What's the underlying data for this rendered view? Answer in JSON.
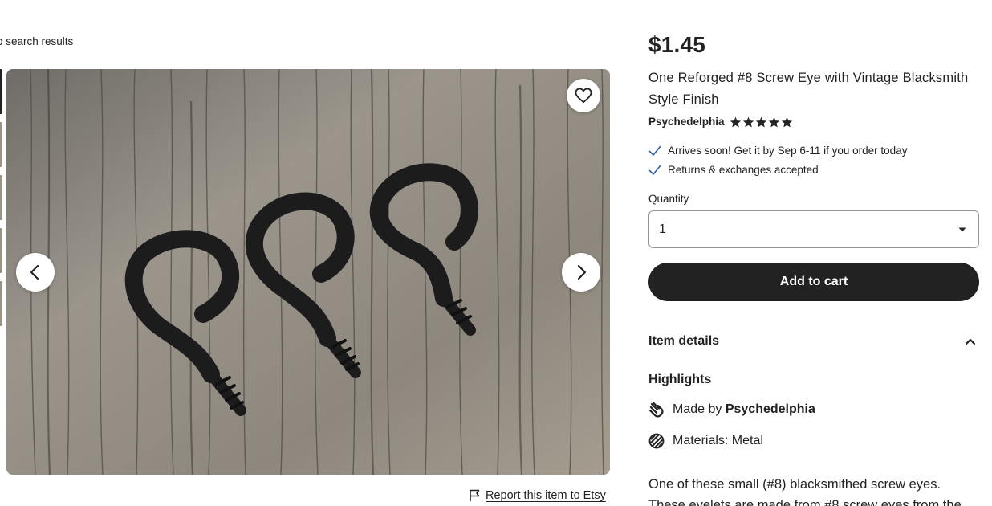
{
  "nav": {
    "back_label": "o search results"
  },
  "gallery": {
    "thumbnail_count": 5,
    "active_thumbnail": 1
  },
  "listing": {
    "price": "$1.45",
    "title": "One Reforged #8 Screw Eye with Vintage Blacksmith Style Finish",
    "shop_name": "Psychedelphia",
    "rating_stars": 5
  },
  "shipping": {
    "arrival_prefix": "Arrives soon! Get it by",
    "arrival_date": "Sep 6-11",
    "arrival_suffix": "if you order today",
    "returns": "Returns & exchanges accepted"
  },
  "purchase": {
    "quantity_label": "Quantity",
    "quantity_value": "1",
    "add_to_cart_label": "Add to cart"
  },
  "details": {
    "section_label": "Item details",
    "highlights_label": "Highlights",
    "made_by_prefix": "Made by",
    "made_by_shop": "Psychedelphia",
    "materials": "Materials: Metal",
    "description_line1": "One of these small (#8) blacksmithed screw eyes.",
    "description_line2": "These eyelets are made from #8 screw eyes from the"
  },
  "report": {
    "label": "Report this item to Etsy"
  },
  "colors": {
    "text": "#222222",
    "check": "#2f5fa8",
    "button_dark": "#222222",
    "wood": "#8f8a82"
  },
  "icons": [
    "heart-icon",
    "chevron-left-icon",
    "chevron-right-icon",
    "star-icon",
    "check-icon",
    "dropdown-caret-icon",
    "chevron-up-icon",
    "hand-icon",
    "materials-icon",
    "flag-icon"
  ]
}
